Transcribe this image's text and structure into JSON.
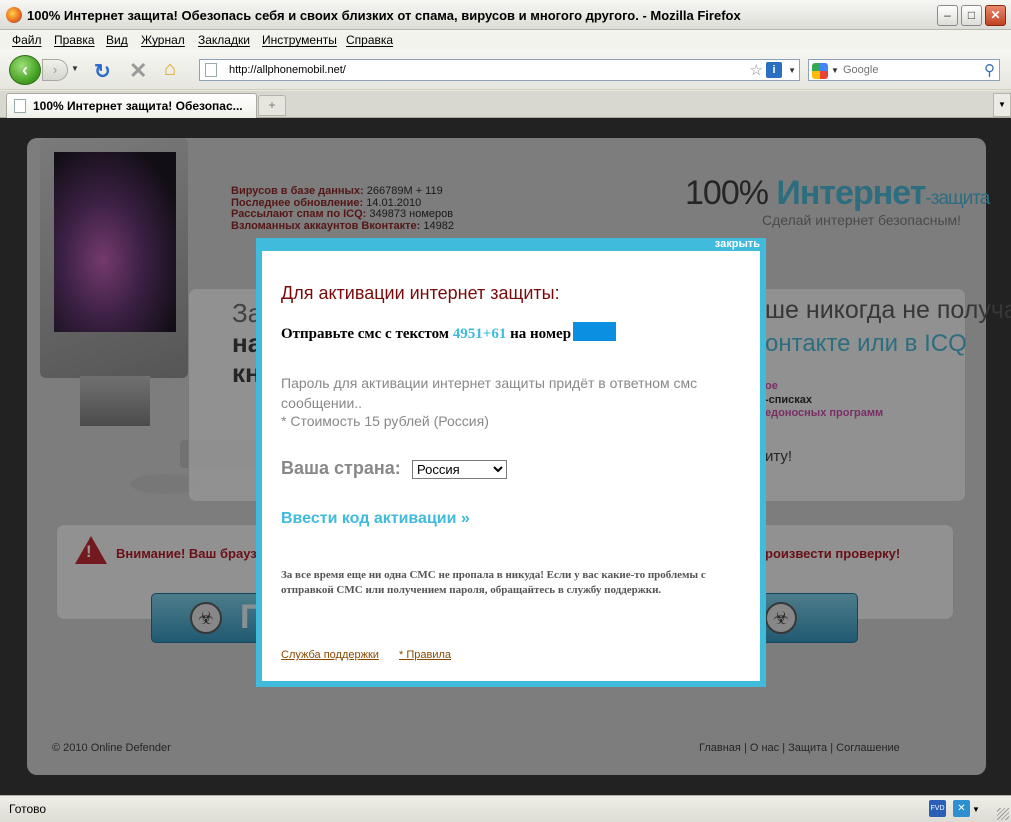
{
  "window": {
    "title": "100% Интернет защита! Обезопась себя и своих близких от спама, вирусов и многого другого. - Mozilla Firefox",
    "minimize": "–",
    "maximize": "□",
    "close": "✕"
  },
  "menu": [
    "Файл",
    "Правка",
    "Вид",
    "Журнал",
    "Закладки",
    "Инструменты",
    "Справка"
  ],
  "nav": {
    "url": "http://allphonemobil.net/",
    "search_placeholder": "Google"
  },
  "tabs": [
    {
      "label": "100% Интернет защита! Обезопас..."
    }
  ],
  "site": {
    "stats": [
      {
        "label": "Вирусов в базе данных:",
        "value": "266789M + 119"
      },
      {
        "label": "Последнее обновление:",
        "value": "14.01.2010"
      },
      {
        "label": "Рассылают спам по ICQ:",
        "value": "349873 номеров"
      },
      {
        "label": "Взломанных аккаунтов Вконтакте:",
        "value": "14982"
      }
    ],
    "brand_pct": "100%",
    "brand_main": "Интернет",
    "brand_suffix": "-защита",
    "brand_sub": "Сделай интернет безопасным!",
    "hero_l1": "За",
    "hero_l2": "на",
    "hero_l3": "кн",
    "hero_r1": "ше никогда не получат",
    "hero_r2": "онтакте или в ICQ",
    "hero_r3": "ое",
    "hero_r4": "-списках",
    "hero_r5": "едоносных программ",
    "hero_r6": "иту!",
    "warn_left": "Внимание! Ваш брауз",
    "warn_right": "роизвести проверку!",
    "scan_label": "П",
    "footer_copy": "© 2010 Online Defender",
    "footer_links": [
      "Главная",
      "О нас",
      "Защита",
      "Соглашение"
    ],
    "footer_sep": "|"
  },
  "modal": {
    "close": "закрыть",
    "title": "Для активации интернет защиты:",
    "sms_prefix": "Отправьте смс с текстом",
    "sms_code": "4951+61",
    "sms_mid": "на номер",
    "info": "Пароль для активации интернет защиты придёт в ответном смс сообщении..",
    "cost": "* Стоимость 15 рублей (Россия)",
    "country_label": "Ваша страна:",
    "country_selected": "Россия",
    "activate": "Ввести код активации »",
    "note": "За все время еще ни одна СМС не пропала в никуда! Если у вас какие-то проблемы с отправкой СМС или получением пароля, обращайтесь в службу поддержки.",
    "link_support": "Служба поддержки",
    "link_rules": "* Правила"
  },
  "status": {
    "text": "Готово",
    "fvd": "FVD"
  }
}
